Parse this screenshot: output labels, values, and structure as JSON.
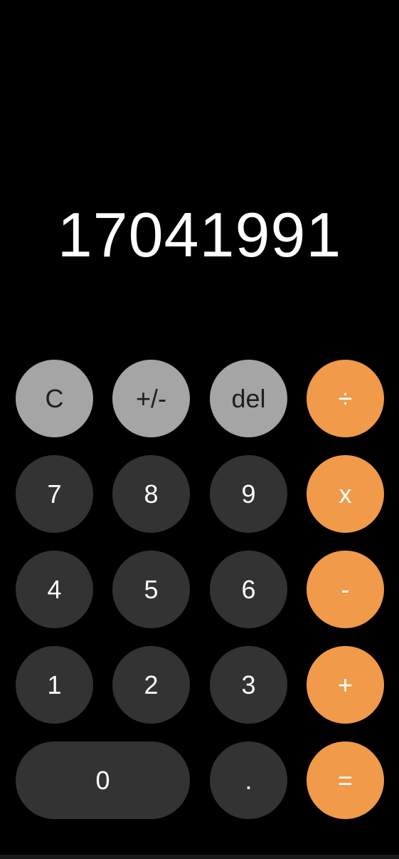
{
  "display": {
    "value": "17041991"
  },
  "keypad": {
    "clear": "C",
    "sign": "+/-",
    "delete": "del",
    "divide": "÷",
    "seven": "7",
    "eight": "8",
    "nine": "9",
    "multiply": "x",
    "four": "4",
    "five": "5",
    "six": "6",
    "subtract": "-",
    "one": "1",
    "two": "2",
    "three": "3",
    "add": "+",
    "zero": "0",
    "decimal": ".",
    "equals": "="
  },
  "colors": {
    "background": "#000000",
    "function_key": "#a5a5a5",
    "number_key": "#333333",
    "operator_key": "#f09a4a"
  }
}
